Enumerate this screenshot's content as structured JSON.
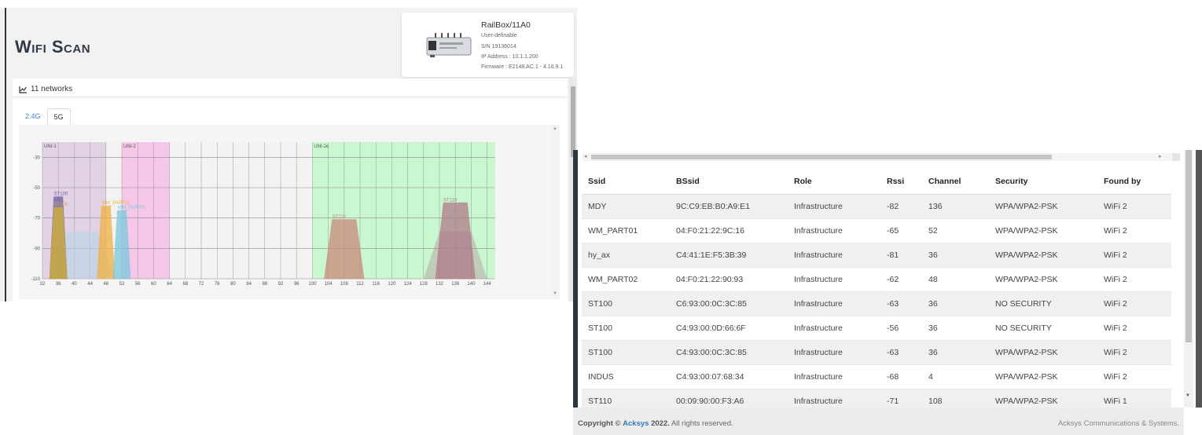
{
  "header": {
    "title": "Wifi Scan"
  },
  "device": {
    "name": "RailBox/11A0",
    "subtitle": "User-definable",
    "serial": "S/N 19136014",
    "ip": "IP Address : 10.1.1.200",
    "firmware": "Firmware : E2148.AC.1 - 4.16.9.1"
  },
  "networks": {
    "count_label": "11 networks",
    "icon": "line-chart-icon"
  },
  "tabs": [
    {
      "label": "2.4G"
    },
    {
      "label": "5G"
    }
  ],
  "chart": {
    "bands": [
      {
        "label": "UNI-1",
        "color": "#e0d0e4"
      },
      {
        "label": "UNI-2",
        "color": "#f6c4e8"
      },
      {
        "label": "UNI-2e",
        "color": "#c6f7cc"
      }
    ],
    "y_ticks": [
      "-30",
      "-50",
      "-70",
      "-90",
      "-110"
    ],
    "x_ticks": [
      "32",
      "36",
      "40",
      "44",
      "48",
      "52",
      "56",
      "60",
      "64",
      "68",
      "72",
      "76",
      "80",
      "84",
      "88",
      "92",
      "96",
      "100",
      "104",
      "108",
      "112",
      "116",
      "120",
      "124",
      "128",
      "132",
      "136",
      "140",
      "144"
    ],
    "signals": [
      {
        "label": "ST100",
        "channel": 36,
        "rssi": -56,
        "color": "#6e5aa6"
      },
      {
        "label": "ST100",
        "channel": 36,
        "rssi": -63,
        "color": "#d4b430"
      },
      {
        "label": "WM_PART02",
        "channel": 48,
        "rssi": -62,
        "color": "#f0b040"
      },
      {
        "label": "WM_PART01",
        "channel": 52,
        "rssi": -65,
        "color": "#7ac8dc"
      },
      {
        "label": "ST110",
        "channel": 108,
        "rssi": -71,
        "color": "#c98a7c"
      },
      {
        "label": "ST110",
        "channel": 136,
        "rssi": -60,
        "color": "#b07a8a"
      }
    ]
  },
  "table": {
    "columns": [
      "Ssid",
      "BSsid",
      "Role",
      "Rssi",
      "Channel",
      "Security",
      "Found by"
    ],
    "rows": [
      [
        "MDY",
        "9C:C9:EB:B0:A9:E1",
        "Infrastructure",
        "-82",
        "136",
        "WPA/WPA2-PSK",
        "WiFi 2"
      ],
      [
        "WM_PART01",
        "04:F0:21:22:9C:16",
        "Infrastructure",
        "-65",
        "52",
        "WPA/WPA2-PSK",
        "WiFi 2"
      ],
      [
        "hy_ax",
        "C4:41:1E:F5:3B:39",
        "Infrastructure",
        "-81",
        "36",
        "WPA/WPA2-PSK",
        "WiFi 2"
      ],
      [
        "WM_PART02",
        "04:F0:21:22:90:93",
        "Infrastructure",
        "-62",
        "48",
        "WPA/WPA2-PSK",
        "WiFi 2"
      ],
      [
        "ST100",
        "C6:93:00:0C:3C:85",
        "Infrastructure",
        "-63",
        "36",
        "NO SECURITY",
        "WiFi 2"
      ],
      [
        "ST100",
        "C4:93:00:0D:66:6F",
        "Infrastructure",
        "-56",
        "36",
        "NO SECURITY",
        "WiFi 2"
      ],
      [
        "ST100",
        "C4:93:00:0C:3C:85",
        "Infrastructure",
        "-63",
        "36",
        "WPA/WPA2-PSK",
        "WiFi 2"
      ],
      [
        "INDUS",
        "C4:93:00:07:68:34",
        "Infrastructure",
        "-68",
        "4",
        "WPA/WPA2-PSK",
        "WiFi 2"
      ],
      [
        "ST110",
        "00:09:90:00:F3:A6",
        "Infrastructure",
        "-71",
        "108",
        "WPA/WPA2-PSK",
        "WiFi 1"
      ]
    ]
  },
  "footer": {
    "copyright_prefix": "Copyright ©",
    "brand": "Acksys",
    "year": "2022.",
    "rights": "All rights reserved.",
    "company": "Acksys Communications & Systems."
  }
}
